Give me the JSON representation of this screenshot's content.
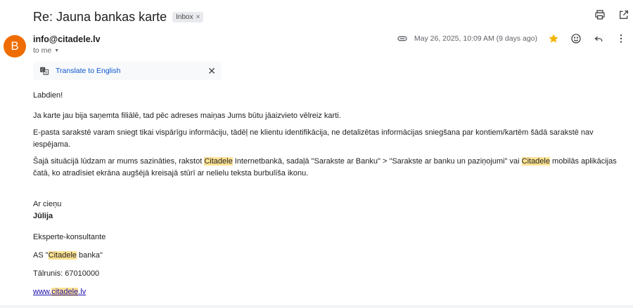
{
  "subject": "Re: Jauna bankas karte",
  "label": {
    "text": "Inbox",
    "remove": "×"
  },
  "avatar_letter": "B",
  "sender": "info@citadele.lv",
  "to": "to me",
  "date": "May 26, 2025, 10:09 AM (9 days ago)",
  "translate": {
    "link": "Translate to English",
    "close": "✕"
  },
  "body": {
    "greeting": "Labdien!",
    "p1": "Ja karte jau bija saņemta filiālē, tad pēc adreses maiņas Jums būtu jāaizvieto vēlreiz karti.",
    "p2": "E-pasta sarakstē varam sniegt tikai vispārīgu informāciju, tādēļ ne klientu identifikācija, ne detalizētas informācijas sniegšana par kontiem/kartēm šādā sarakstē nav iespējama.",
    "p3_a": "Šajā situācijā lūdzam ar mums sazināties, rakstot ",
    "p3_hl1": "Citadele",
    "p3_b": " Internetbankā, sadaļā \"Sarakste ar Banku\" > \"Sarakste ar banku un paziņojumi\" vai ",
    "p3_hl2": "Citadele",
    "p3_c": " mobilās aplikācijas čatā, ko atradīsiet ekrāna augšējā kreisajā stūrī ar nelielu teksta burbulīša ikonu."
  },
  "signature": {
    "closing": "Ar cieņu",
    "name": "Jūlija",
    "role": "Eksperte-konsultante",
    "company_a": "AS \"",
    "company_hl": "Citadele",
    "company_b": " banka\"",
    "phone": "Tālrunis: 67010000",
    "web_a": "www.",
    "web_hl": "citadele",
    "web_b": ".lv"
  },
  "colors": {
    "avatar": "#ef6c00",
    "star": "#f4b400",
    "highlight": "#fde293",
    "link": "#1a0dab",
    "translate_link": "#0b57d0"
  }
}
